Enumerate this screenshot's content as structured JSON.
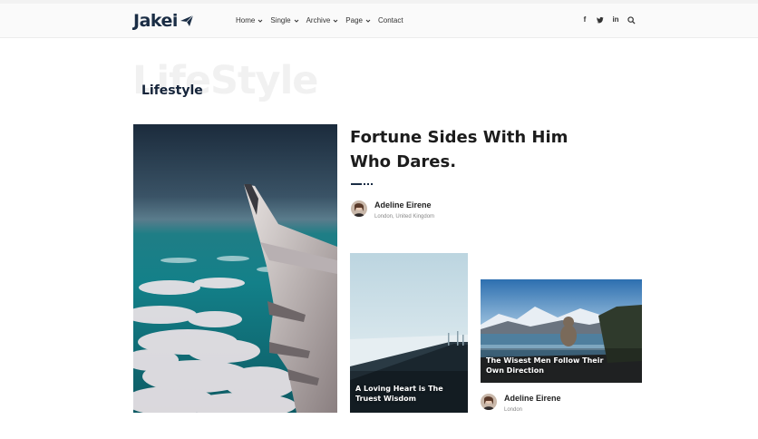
{
  "brand": {
    "logo_text": "Jakei",
    "accent": "#1a2d45"
  },
  "nav": [
    {
      "label": "Home",
      "has_dropdown": true
    },
    {
      "label": "Single",
      "has_dropdown": true
    },
    {
      "label": "Archive",
      "has_dropdown": true
    },
    {
      "label": "Page",
      "has_dropdown": true
    },
    {
      "label": "Contact",
      "has_dropdown": false
    }
  ],
  "social": {
    "facebook": "f",
    "twitter": "t",
    "linkedin": "in"
  },
  "page": {
    "bg_title": "LifeStyle",
    "title": "Lifestyle"
  },
  "featured": {
    "title": "Fortune Sides With Him Who Dares.",
    "author_name": "Adeline Eirene",
    "author_location": "London, United Kingdom"
  },
  "cards": [
    {
      "caption": "A Loving Heart is The Truest Wisdom"
    },
    {
      "caption": "The Wisest Men Follow Their Own Direction",
      "author_name": "Adeline Eirene",
      "author_location": "London"
    }
  ]
}
